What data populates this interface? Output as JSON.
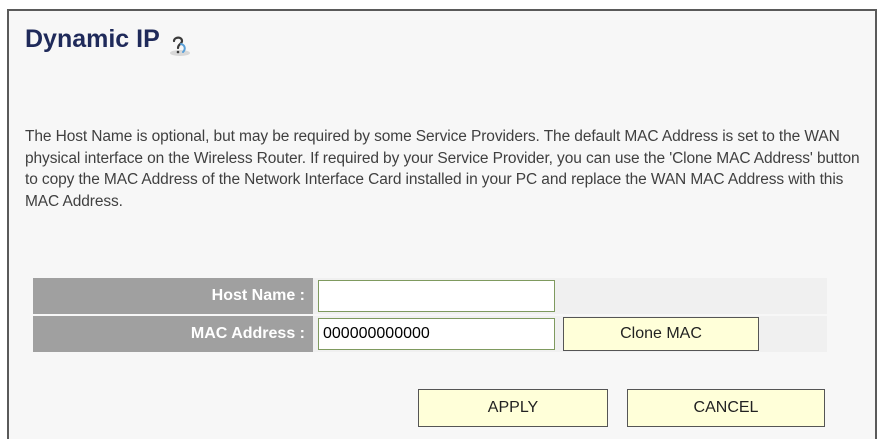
{
  "page": {
    "title": "Dynamic IP",
    "help_icon": "help-icon",
    "description": "The Host Name is optional, but may be required by some Service Providers. The default MAC Address is set to the WAN physical interface on the Wireless Router. If required by your Service Provider, you can use the 'Clone MAC Address' button to copy the MAC Address of the Network Interface Card installed in your PC and replace the WAN MAC Address with this MAC Address."
  },
  "form": {
    "host_name": {
      "label": "Host Name :",
      "value": ""
    },
    "mac_address": {
      "label": "MAC Address :",
      "value": "000000000000",
      "clone_button_label": "Clone MAC"
    }
  },
  "actions": {
    "apply_label": "APPLY",
    "cancel_label": "CANCEL"
  },
  "colors": {
    "title": "#1f2a5a",
    "label_background": "#a0a0a0",
    "button_background": "#ffffd9",
    "panel_background": "#f7f7f7"
  }
}
